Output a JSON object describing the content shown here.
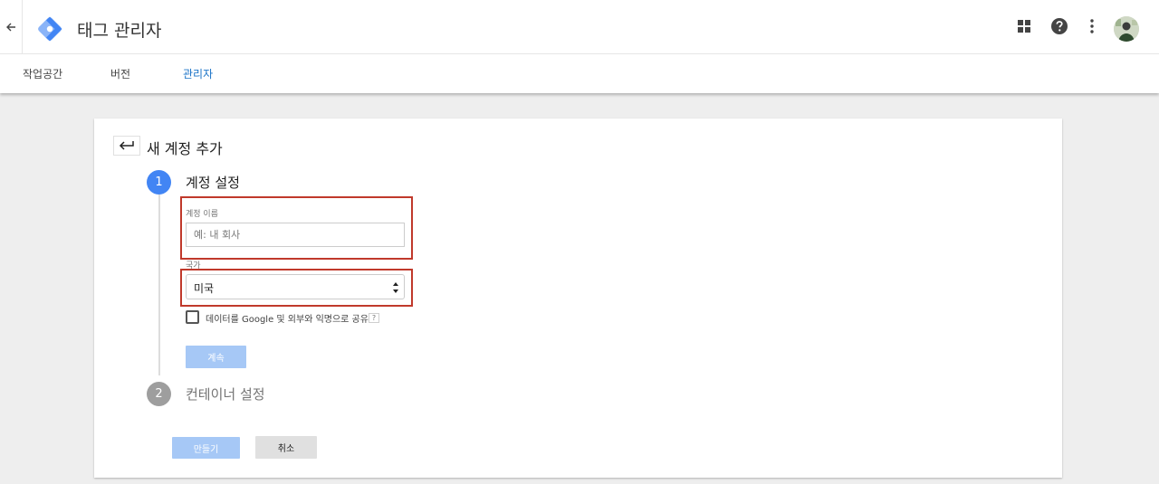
{
  "header": {
    "title": "태그 관리자",
    "brand_color": "#4285f4"
  },
  "icons": {
    "back": "arrow-left-icon",
    "logo": "tag-manager-logo",
    "apps": "apps-grid-icon",
    "help": "help-circle-icon",
    "more": "more-vert-icon",
    "avatar": "user-avatar"
  },
  "nav": {
    "tabs": [
      {
        "label": "작업공간",
        "active": false
      },
      {
        "label": "버전",
        "active": false
      },
      {
        "label": "관리자",
        "active": true
      }
    ],
    "active_color": "#1a73c7"
  },
  "card": {
    "title": "새 계정 추가",
    "step1": {
      "number": "1",
      "title": "계정 설정",
      "account_name": {
        "label": "계정 이름",
        "value": "",
        "placeholder": "예: 내 회사"
      },
      "country": {
        "label": "국가",
        "selected": "미국"
      },
      "share_checkbox": {
        "label": "데이터를 Google 및 외부와 익명으로 공유",
        "checked": false,
        "help": "?"
      },
      "continue_label": "계속"
    },
    "step2": {
      "number": "2",
      "title": "컨테이너 설정"
    },
    "create_label": "만들기",
    "cancel_label": "취소"
  },
  "colors": {
    "step_active": "#4285f4",
    "step_inactive": "#9e9e9e",
    "highlight": "#c0392b",
    "primary_disabled": "#a6c8f6"
  }
}
